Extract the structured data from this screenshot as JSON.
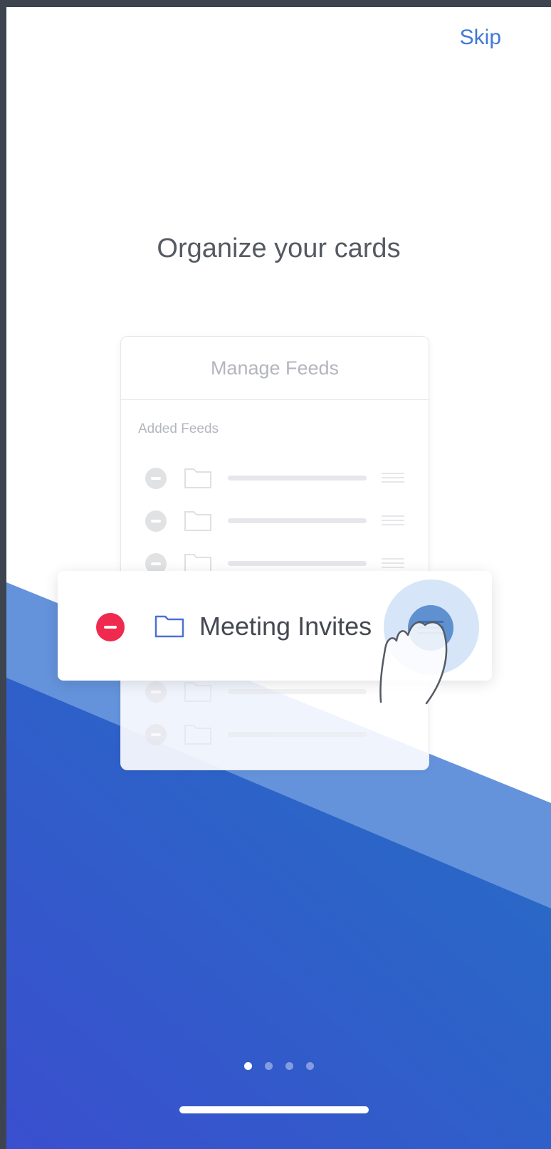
{
  "header": {
    "skip_label": "Skip"
  },
  "title": "Organize your cards",
  "feeds_card": {
    "title": "Manage Feeds",
    "section_label": "Added Feeds"
  },
  "dragged_item": {
    "label": "Meeting Invites"
  },
  "pagination": {
    "total": 4,
    "active_index": 0
  },
  "colors": {
    "accent": "#3f7ad6",
    "remove": "#ef2a4e",
    "folder": "#4a72d3",
    "bg_light_blue": "#6493dc",
    "bg_gradient_start": "#3a4fce",
    "bg_gradient_end": "#2470c4"
  }
}
